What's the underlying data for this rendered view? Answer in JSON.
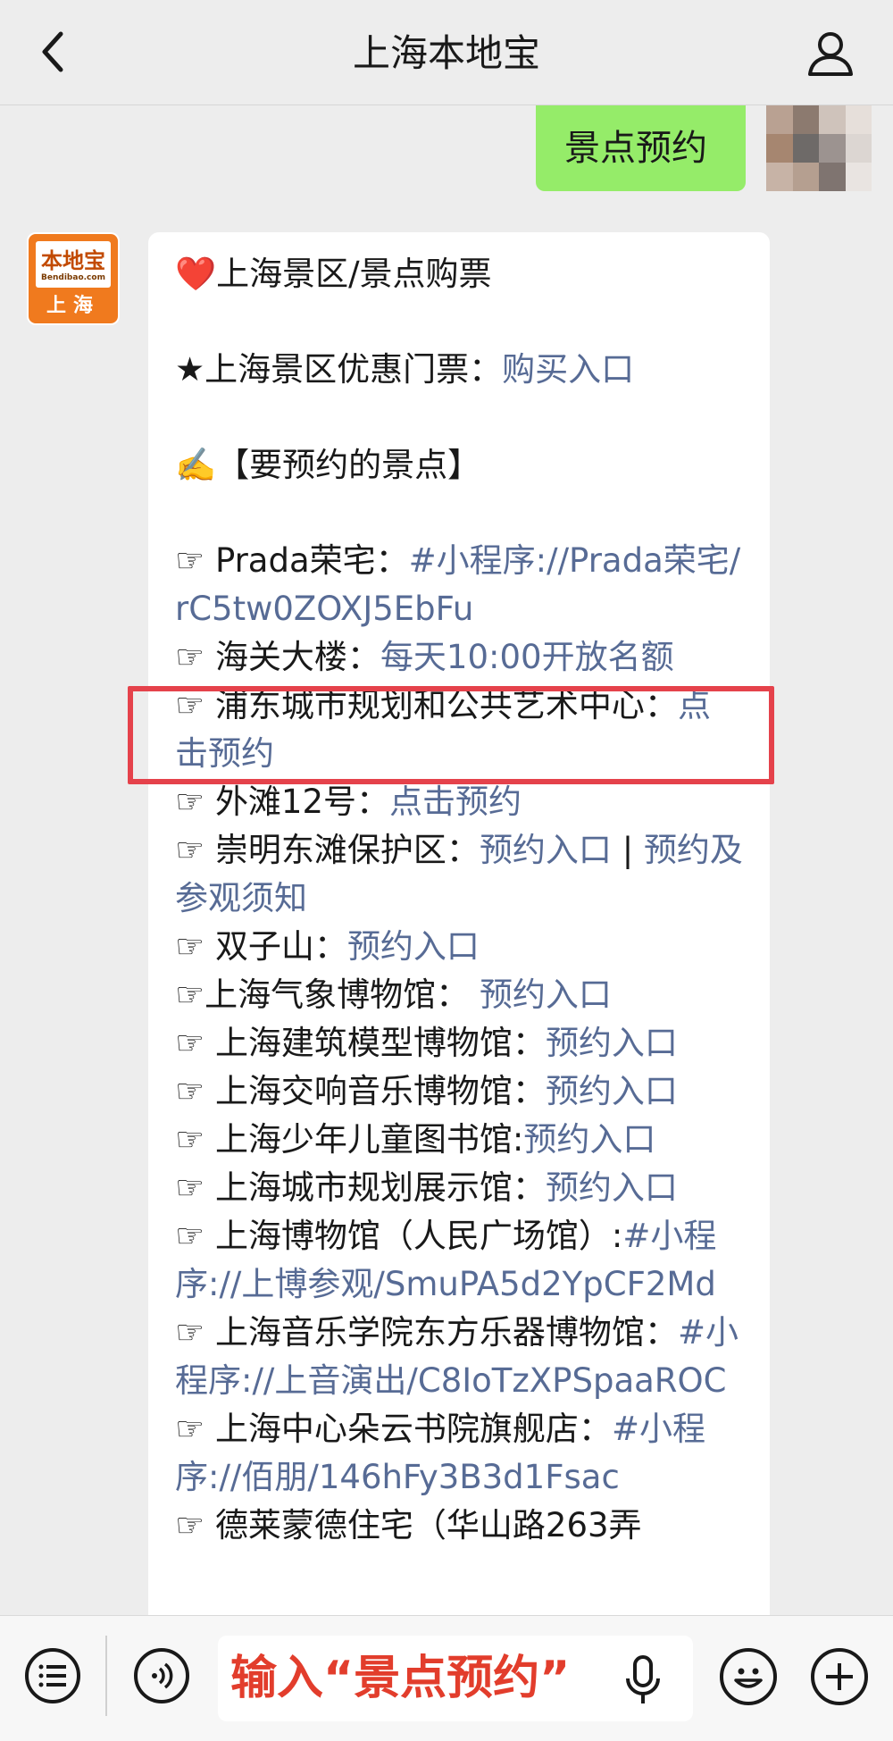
{
  "header": {
    "title": "上海本地宝"
  },
  "outgoing": {
    "text": "景点预约"
  },
  "bot_avatar": {
    "brand": "本地宝",
    "domain": "Bendibao.com",
    "city": "上海"
  },
  "message": {
    "line1_prefix": "❤️",
    "line1_text": "上海景区/景点购票",
    "line2_prefix": "★上海景区优惠门票：",
    "line2_link": "购买入口",
    "line3": "✍️【要预约的景点】",
    "items": [
      {
        "bullet": "☞ ",
        "label": "Prada荣宅：",
        "link": "#小程序://Prada荣宅/rC5tw0ZOXJ5EbFu"
      },
      {
        "bullet": "☞ ",
        "label": "海关大楼：",
        "link": "每天10:00开放名额"
      },
      {
        "bullet": "☞ ",
        "label": "浦东城市规划和公共艺术中心：",
        "link": "点击预约"
      },
      {
        "bullet": "☞ ",
        "label": "外滩12号：",
        "link": "点击预约"
      },
      {
        "bullet": "☞ ",
        "label": "崇明东滩保护区：",
        "link": "预约入口",
        "sep": " | ",
        "link2": "预约及参观须知"
      },
      {
        "bullet": "☞ ",
        "label": "双子山：",
        "link": "预约入口"
      },
      {
        "bullet": "☞",
        "label": "上海气象博物馆：  ",
        "link": "预约入口"
      },
      {
        "bullet": "☞ ",
        "label": "上海建筑模型博物馆：",
        "link": "预约入口"
      },
      {
        "bullet": "☞ ",
        "label": "上海交响音乐博物馆：",
        "link": "预约入口"
      },
      {
        "bullet": "☞ ",
        "label": "上海少年儿童图书馆:",
        "link": "预约入口"
      },
      {
        "bullet": "☞ ",
        "label": "上海城市规划展示馆：",
        "link": "预约入口"
      },
      {
        "bullet": "☞ ",
        "label": "上海博物馆（人民广场馆）:",
        "link": "#小程序://上博参观/SmuPA5d2YpCF2Md"
      },
      {
        "bullet": "☞ ",
        "label": "上海音乐学院东方乐器博物馆：",
        "link": "#小程序://上音演出/C8IoTzXPSpaaROC"
      },
      {
        "bullet": "☞ ",
        "label": "上海中心朵云书院旗舰店：",
        "link": "#小程序://佰朋/146hFy3B3d1Fsac"
      },
      {
        "bullet": "☞ ",
        "label": "德莱蒙德住宅（华山路263弄",
        "link": ""
      }
    ]
  },
  "input": {
    "value": "输入“景点预约”"
  },
  "colors": {
    "background": "#ededed",
    "outgoing_bubble": "#95ec69",
    "link": "#576b95",
    "highlight": "#e5424b",
    "input_text": "#e23d2c"
  },
  "icons": [
    "chevron-left-icon",
    "person-icon",
    "menu-list-icon",
    "voice-icon",
    "mic-icon",
    "emoji-icon",
    "plus-icon"
  ]
}
